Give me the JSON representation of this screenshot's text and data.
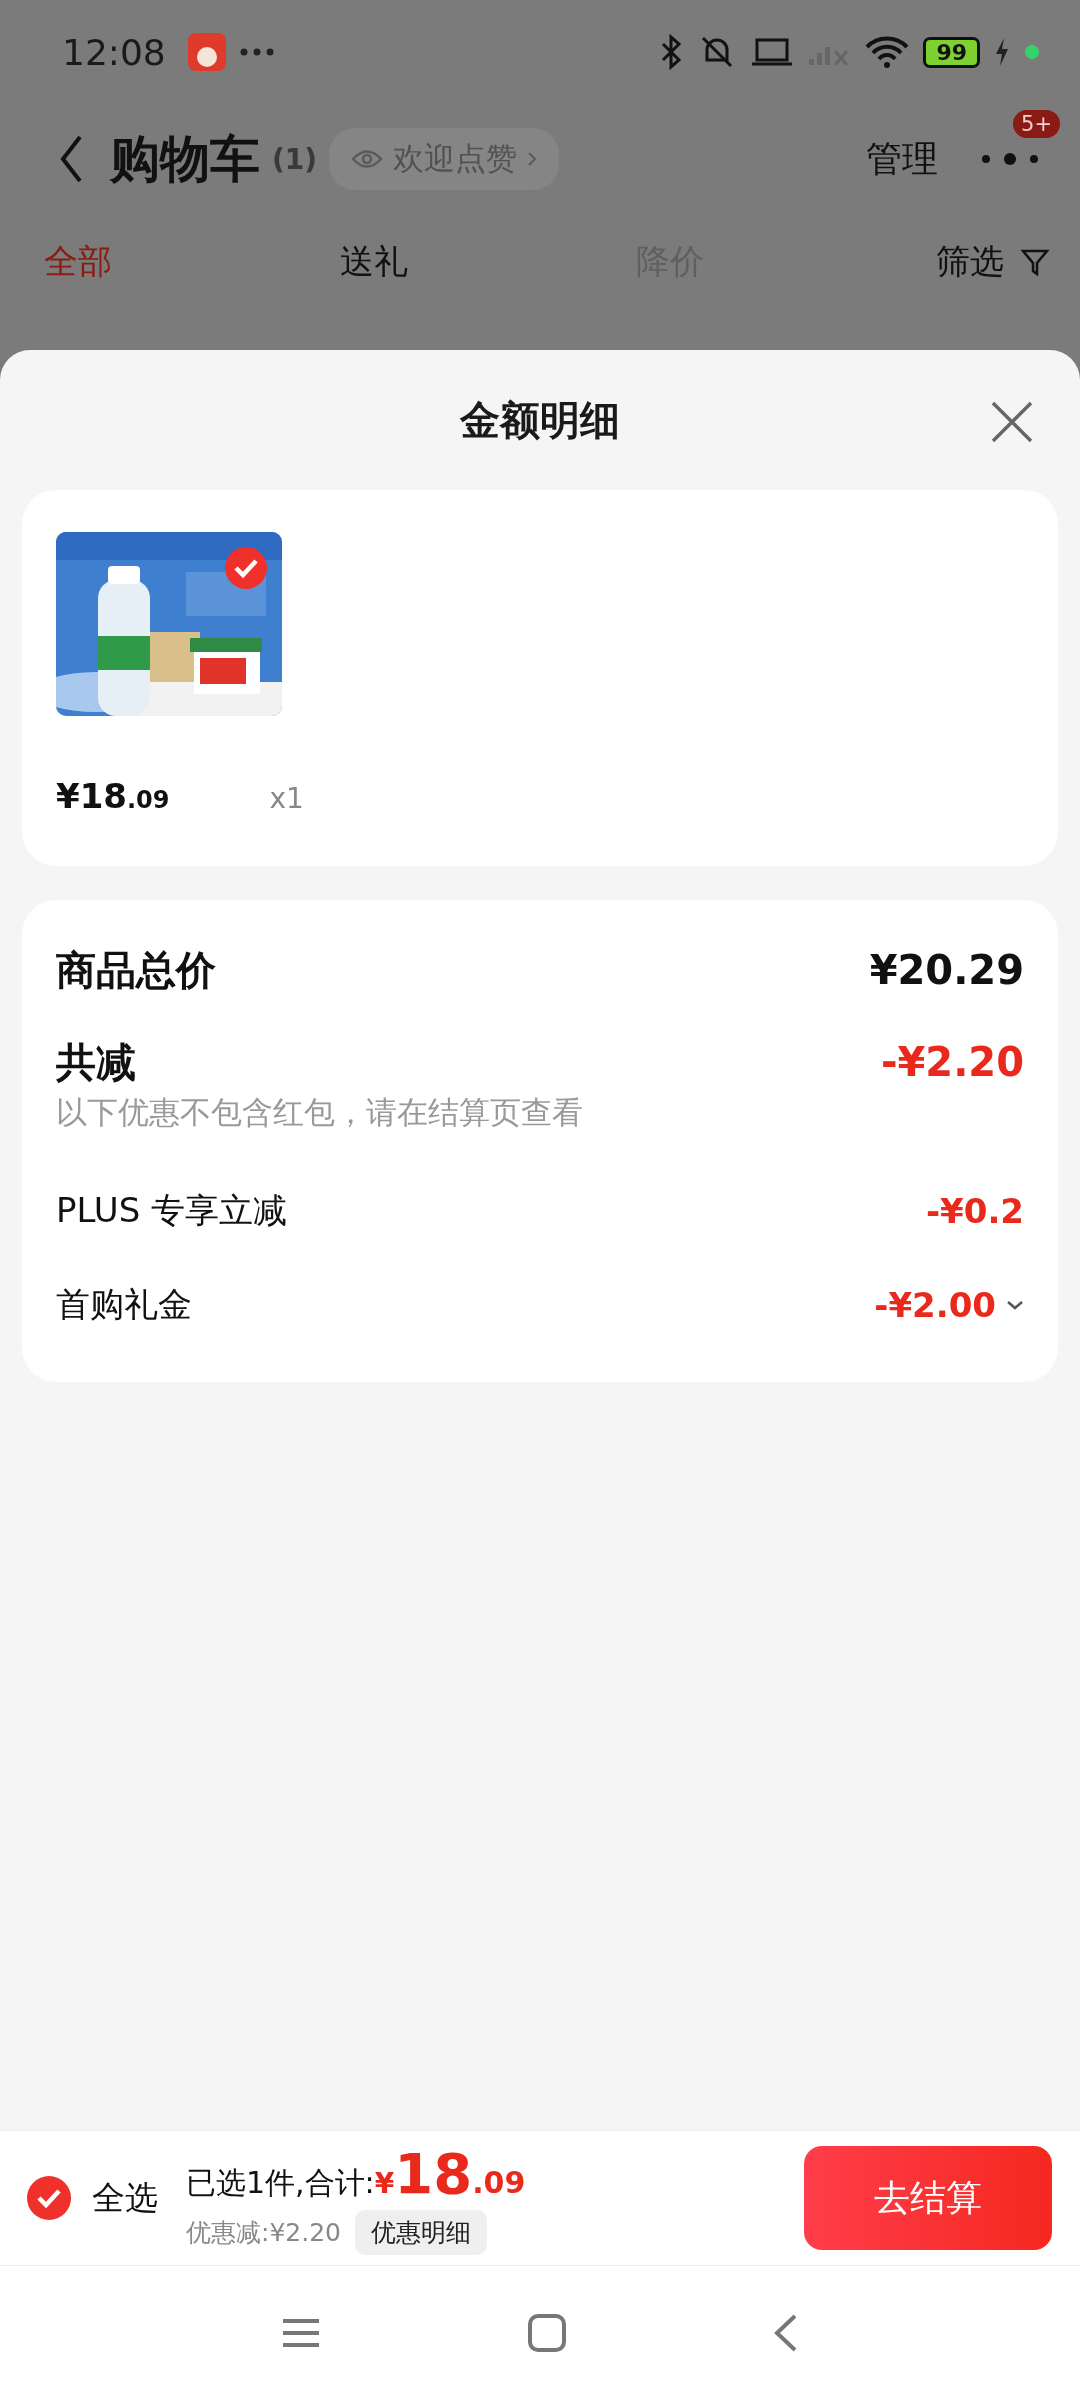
{
  "status_bar": {
    "time": "12:08",
    "battery": "99"
  },
  "header": {
    "title": "购物车",
    "count": "(1)",
    "like_pill": "欢迎点赞",
    "manage": "管理",
    "badge": "5+"
  },
  "tabs": [
    {
      "label": "全部",
      "selected": true,
      "disabled": false
    },
    {
      "label": "送礼",
      "selected": false,
      "disabled": false
    },
    {
      "label": "降价",
      "selected": false,
      "disabled": true
    }
  ],
  "filter": "筛选",
  "sheet": {
    "title": "金额明细",
    "items": [
      {
        "kind": "picture",
        "checked": true,
        "price_main": "¥18",
        "price_decimal": ".09",
        "quantity": "x1"
      }
    ],
    "summary": {
      "total": {
        "label": "商品总价",
        "value": "¥20.29"
      },
      "discount": {
        "label": "共减",
        "value": "-¥2.20",
        "note": "以下优惠不包含红包，请在结算页查看"
      },
      "details": [
        {
          "label": "PLUS 专享立减",
          "value": "-¥0.2",
          "expandable": false
        },
        {
          "label": "首购礼金",
          "value": "-¥2.00",
          "expandable": true
        }
      ]
    }
  },
  "footer": {
    "select_all": {
      "label": "全选",
      "checked": true
    },
    "selected_text": "已选1件,合计:",
    "currency": "¥",
    "total_main": "18",
    "total_decimal": ".09",
    "saved": "优惠减:¥2.20",
    "detail_button": "优惠明细",
    "checkout": "去结算"
  }
}
